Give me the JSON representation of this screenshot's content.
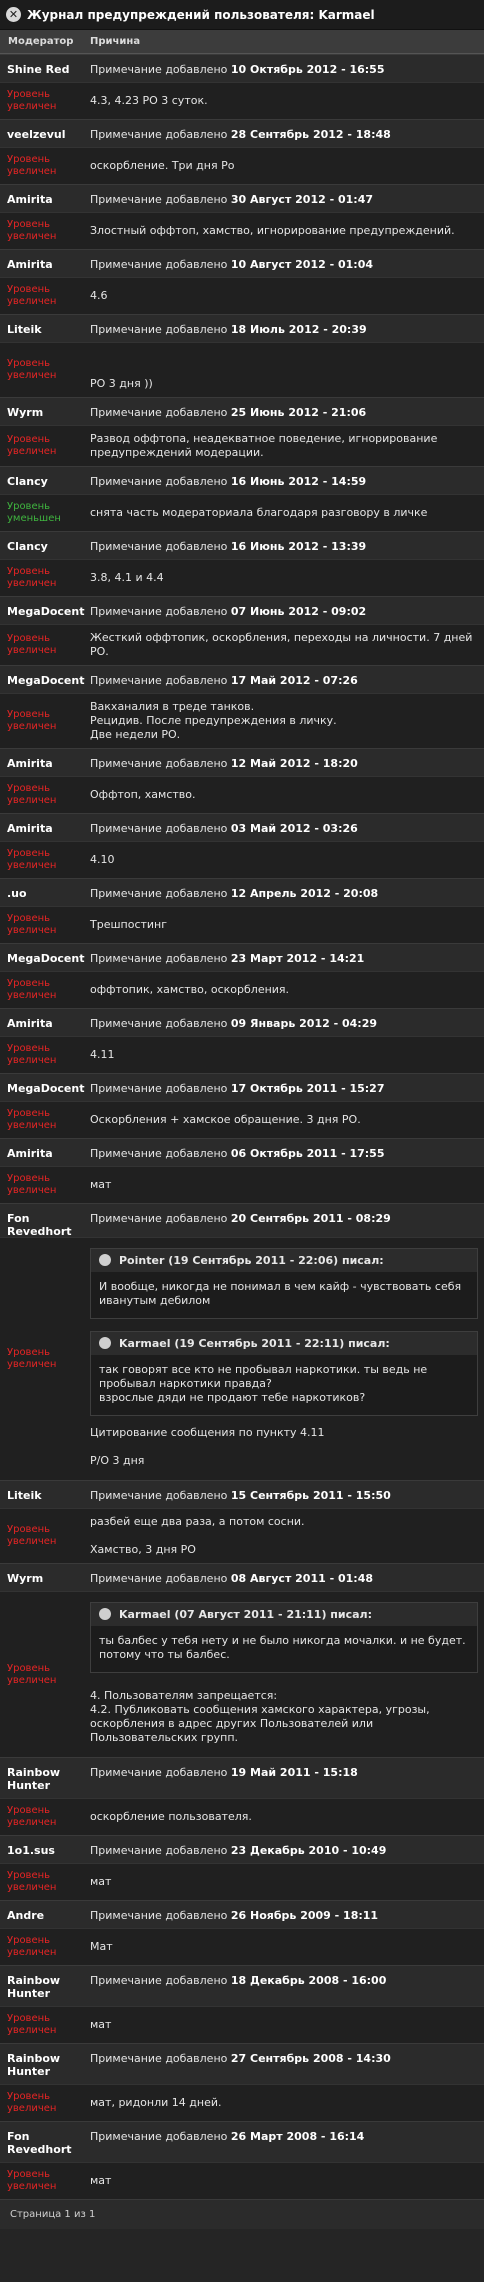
{
  "title": "Журнал предупреждений пользователя: Karmael",
  "columns": {
    "moderator": "Модератор",
    "reason": "Причина"
  },
  "note_prefix": "Примечание добавлено",
  "entries": [
    {
      "moderator": "Shine Red",
      "date": "10 Октябрь 2012 - 16:55",
      "level": "Уровень увеличен",
      "level_type": "up",
      "reason": "4.3, 4.23 РО 3 суток."
    },
    {
      "moderator": "veelzevul",
      "date": "28 Сентябрь 2012 - 18:48",
      "level": "Уровень увеличен",
      "level_type": "up",
      "reason": "оскорбление. Три дня Ро"
    },
    {
      "moderator": "Amirita",
      "date": "30 Август 2012 - 01:47",
      "level": "Уровень увеличен",
      "level_type": "up",
      "reason": "Злостный оффтоп, хамство, игнорирование предупреждений."
    },
    {
      "moderator": "Amirita",
      "date": "10 Август 2012 - 01:04",
      "level": "Уровень увеличен",
      "level_type": "up",
      "reason": "4.6"
    },
    {
      "moderator": "Liteik",
      "date": "18 Июль 2012 - 20:39",
      "level": "Уровень увеличен",
      "level_type": "up",
      "reason": "\n\nРО 3 дня ))"
    },
    {
      "moderator": "Wyrm",
      "date": "25 Июнь 2012 - 21:06",
      "level": "Уровень увеличен",
      "level_type": "up",
      "reason": "Развод оффтопа, неадекватное поведение, игнорирование предупреждений модерации."
    },
    {
      "moderator": "Clancy",
      "date": "16 Июнь 2012 - 14:59",
      "level": "Уровень уменьшен",
      "level_type": "down",
      "reason": "снята часть модераториала благодаря разговору в личке"
    },
    {
      "moderator": "Clancy",
      "date": "16 Июнь 2012 - 13:39",
      "level": "Уровень увеличен",
      "level_type": "up",
      "reason": "3.8, 4.1 и 4.4"
    },
    {
      "moderator": "MegaDocent",
      "date": "07 Июнь 2012 - 09:02",
      "level": "Уровень увеличен",
      "level_type": "up",
      "reason": "Жесткий оффтопик, оскорбления, переходы на личности. 7 дней РО."
    },
    {
      "moderator": "MegaDocent",
      "date": "17 Май 2012 - 07:26",
      "level": "Уровень увеличен",
      "level_type": "up",
      "reason": "Вакханалия в треде танков.\nРецидив. После предупреждения в личку.\nДве недели РО."
    },
    {
      "moderator": "Amirita",
      "date": "12 Май 2012 - 18:20",
      "level": "Уровень увеличен",
      "level_type": "up",
      "reason": "Оффтоп, хамство."
    },
    {
      "moderator": "Amirita",
      "date": "03 Май 2012 - 03:26",
      "level": "Уровень увеличен",
      "level_type": "up",
      "reason": "4.10"
    },
    {
      "moderator": ".uo",
      "date": "12 Апрель 2012 - 20:08",
      "level": "Уровень увеличен",
      "level_type": "up",
      "reason": "Трешпостинг"
    },
    {
      "moderator": "MegaDocent",
      "date": "23 Март 2012 - 14:21",
      "level": "Уровень увеличен",
      "level_type": "up",
      "reason": "оффтопик, хамство, оскорбления."
    },
    {
      "moderator": "Amirita",
      "date": "09 Январь 2012 - 04:29",
      "level": "Уровень увеличен",
      "level_type": "up",
      "reason": "4.11"
    },
    {
      "moderator": "MegaDocent",
      "date": "17 Октябрь 2011 - 15:27",
      "level": "Уровень увеличен",
      "level_type": "up",
      "reason": "Оскорбления + хамское обращение. 3 дня РО."
    },
    {
      "moderator": "Amirita",
      "date": "06 Октябрь 2011 - 17:55",
      "level": "Уровень увеличен",
      "level_type": "up",
      "reason": "мат"
    }
  ],
  "quoted_entry": {
    "moderator": "Fon Revedhort",
    "date": "20 Сентябрь 2011 - 08:29",
    "level": "Уровень увеличен",
    "quote1_head": "Pointer (19 Сентябрь 2011 - 22:06) писал:",
    "quote1_text": "И вообще, никогда не понимал в чем кайф - чувствовать себя иванутым дебилом",
    "quote2_head": "Karmael (19 Сентябрь 2011 - 22:11) писал:",
    "quote2_text": "так говорят все кто не пробывал наркотики. ты ведь не пробывал наркотики правда?\nвзрослые дяди не продают тебе наркотиков?",
    "reason": "Цитирование сообщения по пункту 4.11\n\nР/О 3 дня"
  },
  "liteik_entry": {
    "moderator": "Liteik",
    "date": "15 Сентябрь 2011 - 15:50",
    "level": "Уровень увеличен",
    "reason": "разбей еще два раза, а потом сосни.\n\nХамство, 3 дня РО"
  },
  "wyrm_entry": {
    "moderator": "Wyrm",
    "date": "08 Август 2011 - 01:48",
    "level": "Уровень увеличен",
    "quote_head": "Karmael (07 Август 2011 - 21:11) писал:",
    "quote_text": "ты балбес у тебя нету и не было никогда мочалки. и не будет. потому что ты балбес.",
    "reason": "4. Пользователям запрещается:\n4.2. Публиковать сообщения хамского характера, угрозы, оскорбления в адрес других Пользователей или Пользовательских групп."
  },
  "tail_entries": [
    {
      "moderator": "Rainbow Hunter",
      "date": "19 Май 2011 - 15:18",
      "level": "Уровень увеличен",
      "reason": "оскорбление пользователя."
    },
    {
      "moderator": "1o1.sus",
      "date": "23 Декабрь 2010 - 10:49",
      "level": "Уровень увеличен",
      "reason": "мат"
    },
    {
      "moderator": "Andre",
      "date": "26 Ноябрь 2009 - 18:11",
      "level": "Уровень увеличен",
      "reason": "Мат"
    },
    {
      "moderator": "Rainbow Hunter",
      "date": "18 Декабрь 2008 - 16:00",
      "level": "Уровень увеличен",
      "reason": "мат"
    },
    {
      "moderator": "Rainbow Hunter",
      "date": "27 Сентябрь 2008 - 14:30",
      "level": "Уровень увеличен",
      "reason": "мат, ридонли 14 дней."
    },
    {
      "moderator": "Fon Revedhort",
      "date": "26 Март 2008 - 16:14",
      "level": "Уровень увеличен",
      "reason": "мат"
    }
  ],
  "footer": "Страница 1 из 1",
  "colors": {
    "level_up": "#e62525",
    "level_down": "#3fb43f"
  }
}
